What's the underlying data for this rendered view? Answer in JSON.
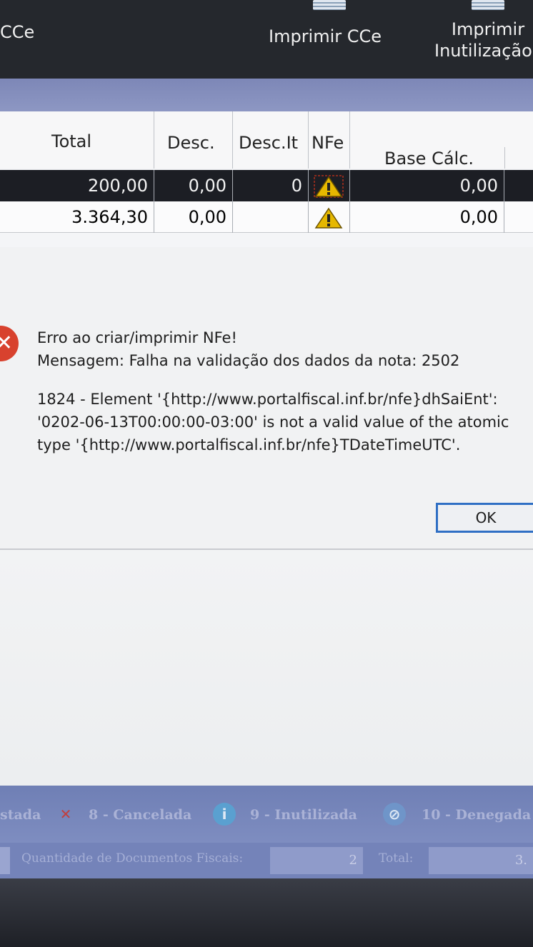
{
  "toolbar": {
    "items": [
      {
        "label": "CCe"
      },
      {
        "label": "Imprimir CCe"
      },
      {
        "label_line1": "Imprimir",
        "label_line2": "Inutilização"
      }
    ]
  },
  "grid": {
    "columns": [
      "Total",
      "Desc.",
      "Desc.It",
      "NFe",
      "Base Cálc."
    ],
    "rows": [
      {
        "total": "200,00",
        "desc": "0,00",
        "desc_it": "0",
        "nfe_status": "warning-icon",
        "base_calc": "0,00",
        "selected": true
      },
      {
        "total": "3.364,30",
        "desc": "0,00",
        "desc_it": "",
        "nfe_status": "warning-icon",
        "base_calc": "0,00",
        "selected": false
      }
    ]
  },
  "dialog": {
    "title_line": "Erro ao criar/imprimir NFe!",
    "message_line": "Mensagem: Falha na validação dos dados da nota: 2502",
    "detail_line1": "1824 - Element '{http://www.portalfiscal.inf.br/nfe}dhSaiEnt':",
    "detail_line2": "'0202-06-13T00:00:00-03:00' is not a valid value of the atomic",
    "detail_line3": "type '{http://www.portalfiscal.inf.br/nfe}TDateTimeUTC'.",
    "ok_label": "OK",
    "icon": "error-icon"
  },
  "legend": {
    "items": [
      {
        "label": "stada",
        "icon": ""
      },
      {
        "label": "8 - Cancelada",
        "icon": "cancel-x-icon"
      },
      {
        "label": "9 - Inutilizada",
        "icon": "info-icon"
      },
      {
        "label": "10 - Denegada",
        "icon": "denied-icon"
      }
    ]
  },
  "status": {
    "qty_label": "Quantidade de Documentos Fiscais:",
    "qty_value": "2",
    "total_label": "Total:",
    "total_value": "3."
  },
  "colors": {
    "selected_row": "#1c1e24",
    "warning": "#e6b800",
    "error": "#d8422e",
    "ok_border": "#2f6fc4"
  }
}
